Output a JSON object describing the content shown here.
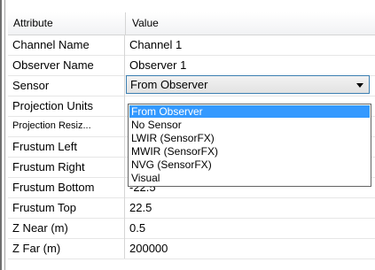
{
  "header": {
    "attribute": "Attribute",
    "value": "Value"
  },
  "rows": [
    {
      "attr": "Channel Name",
      "value": "Channel 1"
    },
    {
      "attr": "Observer Name",
      "value": "Observer 1"
    },
    {
      "attr": "Sensor",
      "value": "From Observer"
    },
    {
      "attr": "Projection Units",
      "value": ""
    },
    {
      "attr": "Projection Resiz...",
      "value": ""
    },
    {
      "attr": "Frustum Left",
      "value": ""
    },
    {
      "attr": "Frustum Right",
      "value": ""
    },
    {
      "attr": "Frustum Bottom",
      "value": "-22.5"
    },
    {
      "attr": "Frustum Top",
      "value": "22.5"
    },
    {
      "attr": "Z Near (m)",
      "value": "0.5"
    },
    {
      "attr": "Z Far (m)",
      "value": "200000"
    }
  ],
  "dropdown": {
    "options": [
      "From Observer",
      "No Sensor",
      "LWIR (SensorFX)",
      "MWIR (SensorFX)",
      "NVG (SensorFX)",
      "Visual"
    ],
    "selected": "From Observer"
  },
  "colors": {
    "selection": "#3399ff",
    "combo_border": "#3c7fb1"
  }
}
